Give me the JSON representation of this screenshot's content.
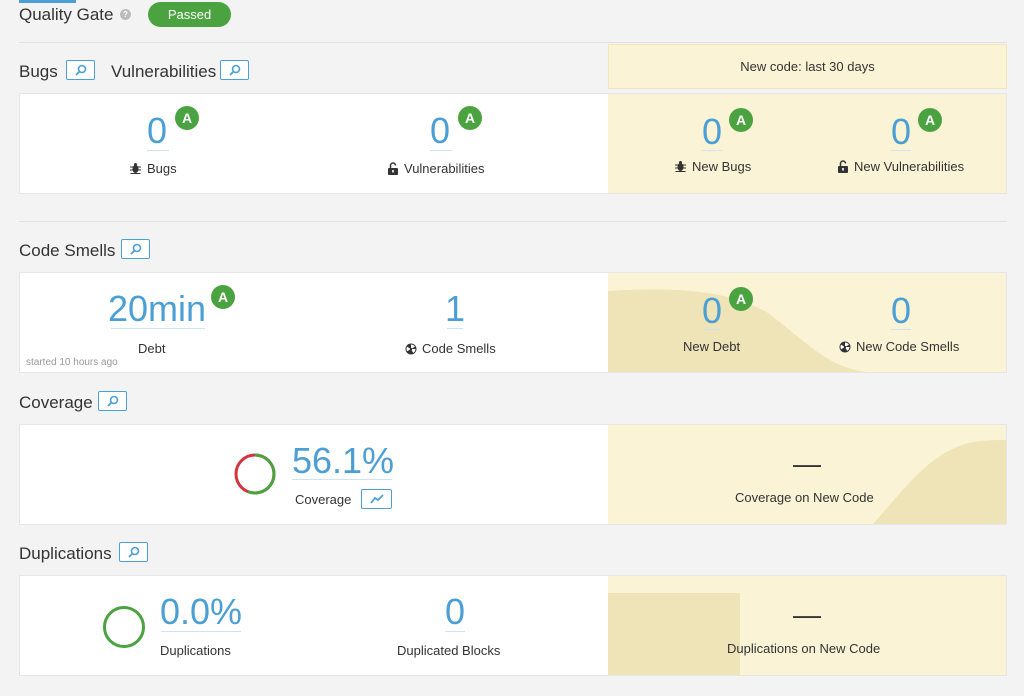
{
  "quality_gate": {
    "label": "Quality Gate",
    "help": "?",
    "status": "Passed"
  },
  "new_code": {
    "banner": "New code: last 30 days"
  },
  "sections": {
    "bugs_title": "Bugs",
    "vulnerabilities_title": "Vulnerabilities",
    "code_smells_title": "Code Smells",
    "coverage_title": "Coverage",
    "duplications_title": "Duplications"
  },
  "bugs_panel": {
    "bugs_value": "0",
    "bugs_rating": "A",
    "bugs_label": "Bugs",
    "vuln_value": "0",
    "vuln_rating": "A",
    "vuln_label": "Vulnerabilities",
    "new_bugs_value": "0",
    "new_bugs_rating": "A",
    "new_bugs_label": "New Bugs",
    "new_vuln_value": "0",
    "new_vuln_rating": "A",
    "new_vuln_label": "New Vulnerabilities"
  },
  "smells_panel": {
    "debt_value": "20min",
    "debt_rating": "A",
    "debt_label": "Debt",
    "started_note": "started 10 hours ago",
    "smells_value": "1",
    "smells_label": "Code Smells",
    "new_debt_value": "0",
    "new_debt_rating": "A",
    "new_debt_label": "New Debt",
    "new_smells_value": "0",
    "new_smells_label": "New Code Smells"
  },
  "coverage_panel": {
    "coverage_value": "56.1%",
    "coverage_fraction": 0.561,
    "coverage_label": "Coverage",
    "new_coverage_value": "—",
    "new_coverage_label": "Coverage on New Code"
  },
  "duplications_panel": {
    "dup_value": "0.0%",
    "dup_label": "Duplications",
    "blocks_value": "0",
    "blocks_label": "Duplicated Blocks",
    "new_dup_value": "—",
    "new_dup_label": "Duplications on New Code"
  },
  "colors": {
    "accent": "#4b9fd5",
    "pass_green": "#4aa340",
    "fail_red": "#d4333f",
    "leak_bg": "#fbf3d5",
    "leak_shape": "#efe4b8"
  },
  "icons": [
    "help-icon",
    "drilldown-icon",
    "bug-icon",
    "unlock-icon",
    "smell-icon",
    "history-chart-icon",
    "donut-icon"
  ]
}
